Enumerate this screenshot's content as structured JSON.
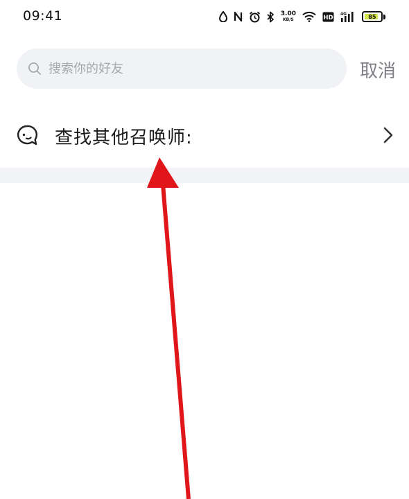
{
  "status_bar": {
    "time": "09:41",
    "netspeed_value": "3.00",
    "netspeed_unit": "KB/S",
    "battery_level": "85",
    "icons": [
      "water-drop-icon",
      "nfc-icon",
      "alarm-icon",
      "bluetooth-icon",
      "wifi-icon",
      "hd-icon",
      "signal-4g-icon",
      "battery-icon"
    ]
  },
  "search": {
    "placeholder": "搜索你的好友",
    "value": "",
    "cancel_label": "取消"
  },
  "find_other": {
    "label": "查找其他召唤师:"
  },
  "colors": {
    "search_bg": "#f1f2f6",
    "divider_band": "#f3f4f7",
    "annotation_arrow": "#e0161b",
    "battery_fill": "#d6e64a"
  }
}
